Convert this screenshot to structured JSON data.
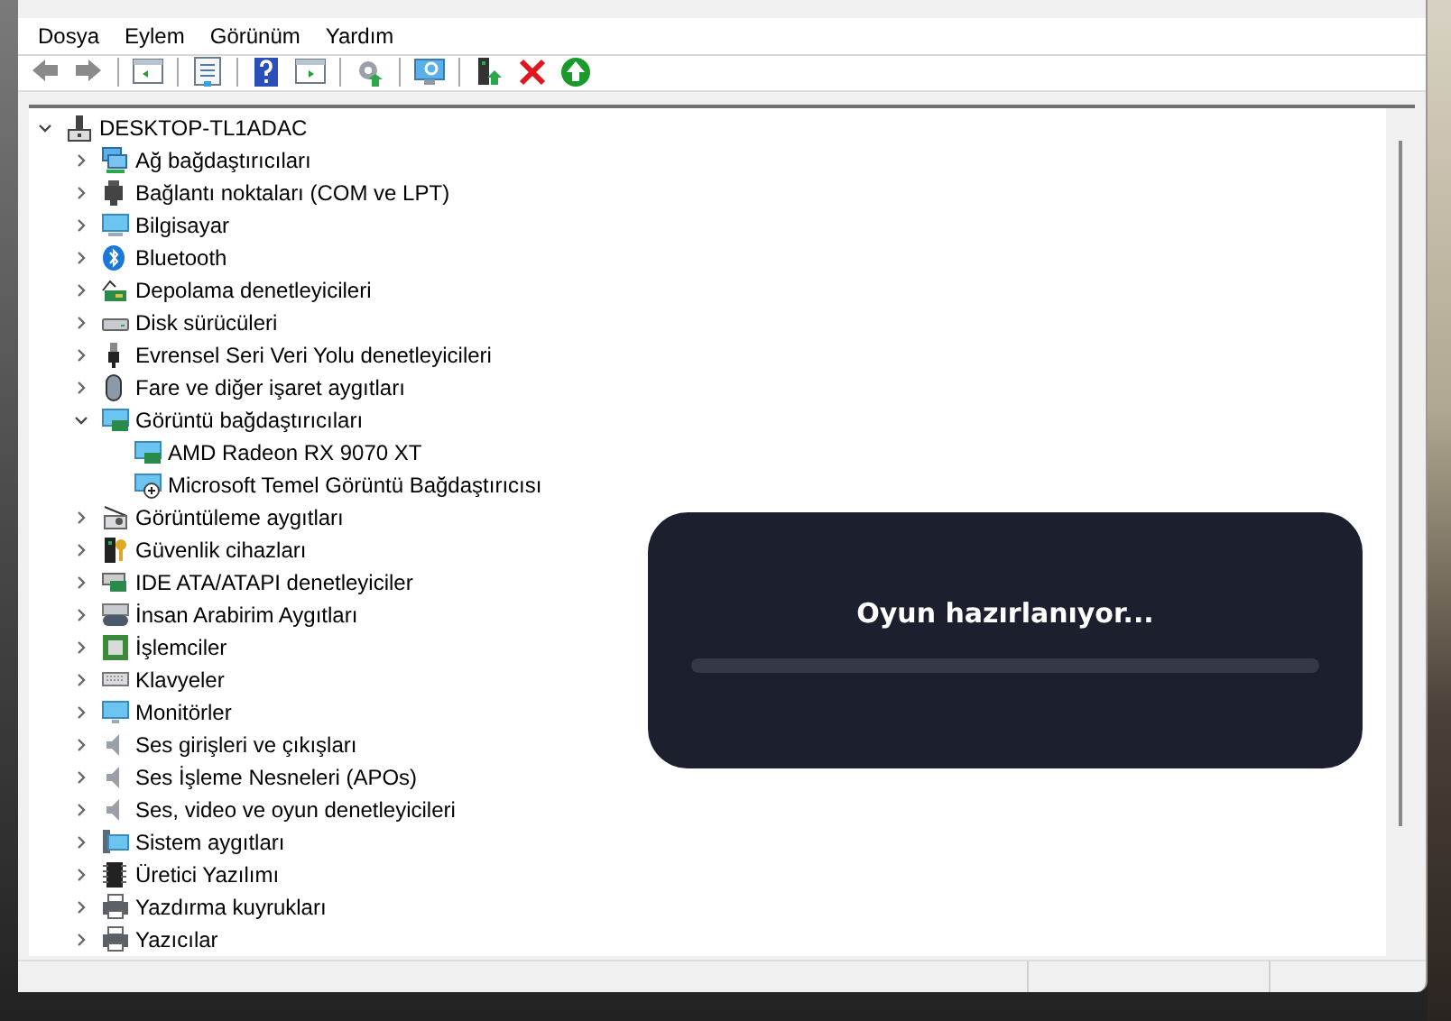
{
  "menu": [
    {
      "label": "Dosya"
    },
    {
      "label": "Eylem"
    },
    {
      "label": "Görünüm"
    },
    {
      "label": "Yardım"
    }
  ],
  "tree": {
    "label": "DESKTOP-TL1ADAC",
    "expanded": true,
    "children": [
      {
        "label": "Ağ bağdaştırıcıları",
        "expanded": false
      },
      {
        "label": "Bağlantı noktaları (COM ve LPT)",
        "expanded": false
      },
      {
        "label": "Bilgisayar",
        "expanded": false
      },
      {
        "label": "Bluetooth",
        "expanded": false
      },
      {
        "label": "Depolama denetleyicileri",
        "expanded": false
      },
      {
        "label": "Disk sürücüleri",
        "expanded": false
      },
      {
        "label": "Evrensel Seri Veri Yolu denetleyicileri",
        "expanded": false
      },
      {
        "label": "Fare ve diğer işaret aygıtları",
        "expanded": false
      },
      {
        "label": "Görüntü bağdaştırıcıları",
        "expanded": true,
        "children": [
          {
            "label": "AMD Radeon RX 9070 XT"
          },
          {
            "label": "Microsoft Temel Görüntü Bağdaştırıcısı"
          }
        ]
      },
      {
        "label": "Görüntüleme aygıtları",
        "expanded": false
      },
      {
        "label": "Güvenlik cihazları",
        "expanded": false
      },
      {
        "label": "IDE ATA/ATAPI denetleyiciler",
        "expanded": false
      },
      {
        "label": "İnsan Arabirim Aygıtları",
        "expanded": false
      },
      {
        "label": "İşlemciler",
        "expanded": false
      },
      {
        "label": "Klavyeler",
        "expanded": false
      },
      {
        "label": "Monitörler",
        "expanded": false
      },
      {
        "label": "Ses girişleri ve çıkışları",
        "expanded": false
      },
      {
        "label": "Ses İşleme Nesneleri (APOs)",
        "expanded": false
      },
      {
        "label": "Ses, video ve oyun denetleyicileri",
        "expanded": false
      },
      {
        "label": "Sistem aygıtları",
        "expanded": false
      },
      {
        "label": "Üretici Yazılımı",
        "expanded": false
      },
      {
        "label": "Yazdırma kuyrukları",
        "expanded": false
      },
      {
        "label": "Yazıcılar",
        "expanded": false
      }
    ]
  },
  "overlay": {
    "message": "Oyun hazırlanıyor..."
  }
}
